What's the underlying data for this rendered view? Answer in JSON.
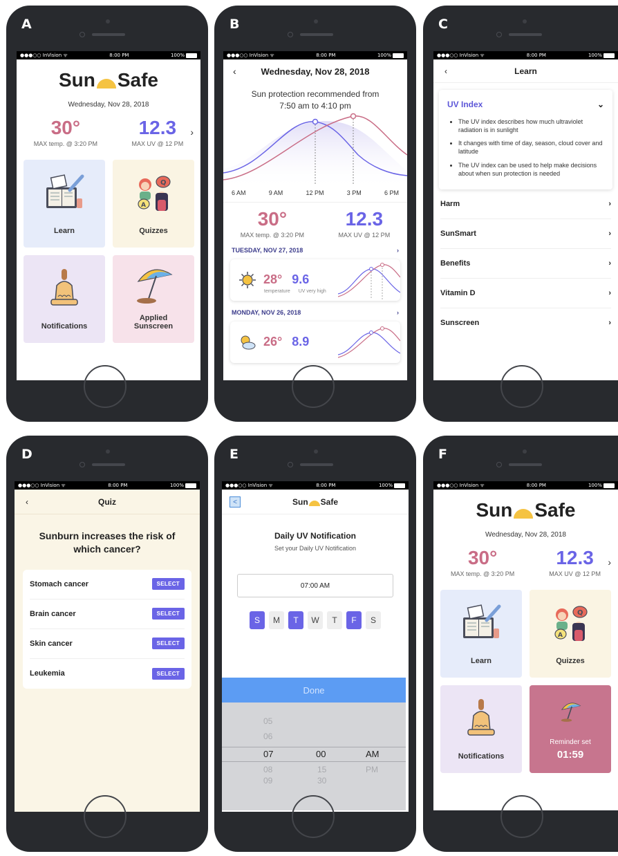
{
  "panels": {
    "a": "A",
    "b": "B",
    "c": "C",
    "d": "D",
    "e": "E",
    "f": "F"
  },
  "status": {
    "carrier": "●●●○○ InVision ᯤ",
    "time": "8:00 PM",
    "battery": "100%"
  },
  "app": {
    "name_left": "Sun",
    "name_right": "Safe"
  },
  "home": {
    "date": "Wednesday, Nov 28, 2018",
    "temp": "30°",
    "temp_caption": "MAX temp. @ 3:20 PM",
    "uv": "12.3",
    "uv_caption": "MAX UV @ 12 PM",
    "next": "›",
    "tiles": {
      "learn": "Learn",
      "quizzes": "Quizzes",
      "notifications": "Notifications",
      "applied_line1": "Applied",
      "applied_line2": "Sunscreen",
      "reminder_label": "Reminder set",
      "reminder_time": "01:59"
    }
  },
  "detail": {
    "back": "‹",
    "title": "Wednesday, Nov 28, 2018",
    "rec_line1": "Sun protection recommended from",
    "rec_line2": "7:50 am to 4:10 pm",
    "times": [
      "6 AM",
      "9 AM",
      "12 PM",
      "3 PM",
      "6 PM"
    ],
    "temp": "30°",
    "temp_caption": "MAX temp. @ 3:20 PM",
    "uv": "12.3",
    "uv_caption": "MAX UV @ 12 PM",
    "days": [
      {
        "label": "TUESDAY, NOV 27, 2018",
        "temp": "28°",
        "uv": "9.6",
        "temp_label": "temperature",
        "uv_label": "UV very high"
      },
      {
        "label": "MONDAY, NOV 26, 2018",
        "temp": "26°",
        "uv": "8.9"
      }
    ],
    "chevron": "›"
  },
  "learn": {
    "back": "‹",
    "title": "Learn",
    "uv_title": "UV Index",
    "uv_toggle": "⌄",
    "bullets": [
      "The UV index describes how much ultraviolet radiation is in sunlight",
      "It changes with time of day, season, cloud cover and latitude",
      "The UV index can be used to help make decisions about when sun protection is needed"
    ],
    "topics": [
      "Harm",
      "SunSmart",
      "Benefits",
      "Vitamin D",
      "Sunscreen"
    ],
    "chevron": "›"
  },
  "quiz": {
    "back": "‹",
    "title": "Quiz",
    "question": "Sunburn increases the risk of which cancer?",
    "select_label": "SELECT",
    "options": [
      "Stomach cancer",
      "Brain cancer",
      "Skin cancer",
      "Leukemia"
    ]
  },
  "notification": {
    "back": "<",
    "title": "Daily UV Notification",
    "subtitle": "Set your Daily UV Notification",
    "time": "07:00 AM",
    "days": [
      "S",
      "M",
      "T",
      "W",
      "T",
      "F",
      "S"
    ],
    "active_days": [
      0,
      2,
      5
    ],
    "done": "Done",
    "picker": {
      "hours": [
        "05",
        "06",
        "07",
        "08",
        "09"
      ],
      "minutes": [
        "00",
        "15",
        "30"
      ],
      "periods": [
        "AM",
        "PM"
      ]
    }
  },
  "colors": {
    "temp": "#c96d86",
    "uv": "#6a64e6",
    "sun": "#f5c342",
    "done": "#5c9cf3",
    "reminder": "#c7758e"
  }
}
